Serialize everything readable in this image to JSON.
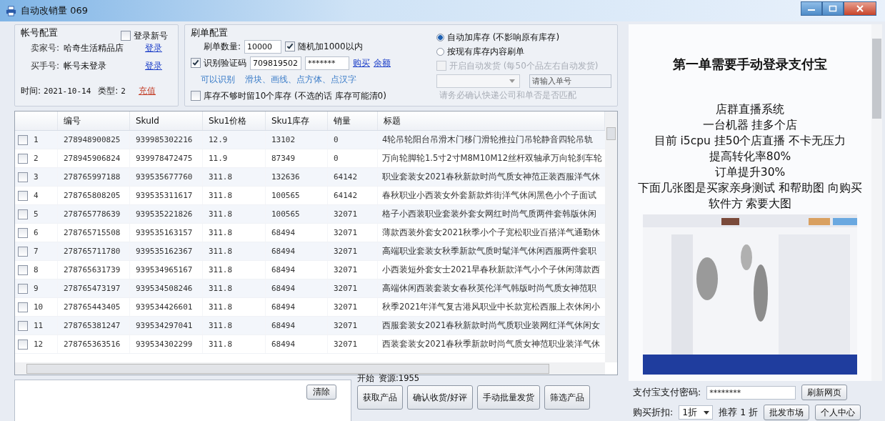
{
  "window": {
    "title": "自动改销量 069"
  },
  "account": {
    "title": "帐号配置",
    "login_new": {
      "label": "登录新号",
      "checked": false
    },
    "rows": [
      {
        "label": "卖家号:",
        "value": "哈奇生活精品店",
        "link": "登录"
      },
      {
        "label": "买手号:",
        "value": "帐号未登录",
        "link": "登录"
      }
    ],
    "time_label": "时间:",
    "time": "2021-10-14",
    "type_label": "类型:",
    "type": "2",
    "recharge": "充值"
  },
  "order_config": {
    "title": "刷单配置",
    "quantity_label": "刷单数量:",
    "quantity": "10000",
    "random": {
      "label": "随机加1000以内",
      "checked": true
    },
    "captcha": {
      "label": "识别验证码",
      "checked": true
    },
    "captcha_user": "709819502",
    "captcha_pass": "*******",
    "buy": "购买",
    "balance": "余额",
    "recognize_label": "可以识别",
    "recognize_types": "滑块、画线、点方体、点汉字",
    "keep_stock": {
      "label": "库存不够时留10个库存 (不选的话 库存可能清0)",
      "checked": false
    },
    "modes": [
      {
        "label": "自动加库存 (不影响原有库存)",
        "selected": true
      },
      {
        "label": "按现有库存内容刷单",
        "selected": false
      }
    ],
    "auto_ship": {
      "label": "开启自动发货 (每50个品左右自动发货)",
      "checked": false,
      "disabled": true
    },
    "order_no_placeholder": "请输入单号",
    "ship_note": "请务必确认快递公司和单否是否匹配"
  },
  "table": {
    "columns": [
      "编号",
      "SkuId",
      "Sku1价格",
      "Sku1库存",
      "销量",
      "标题"
    ],
    "rows": [
      {
        "checked": false,
        "n": "1",
        "cells": [
          "278948900825",
          "939985302216",
          "12.9",
          "13102",
          "0",
          "4轮吊轮阳台吊滑木门移门滑轮推拉门吊轮静音四轮吊轨"
        ]
      },
      {
        "checked": false,
        "n": "2",
        "cells": [
          "278945906824",
          "939978472475",
          "11.9",
          "87349",
          "0",
          "万向轮脚轮1.5寸2寸M8M10M12丝杆双轴承万向轮刹车轮"
        ]
      },
      {
        "checked": false,
        "n": "3",
        "cells": [
          "278765997188",
          "939535677760",
          "311.8",
          "132636",
          "64142",
          "职业套装女2021春秋新款时尚气质女神范正装西服洋气休"
        ]
      },
      {
        "checked": false,
        "n": "4",
        "cells": [
          "278765808205",
          "939535311617",
          "311.8",
          "100565",
          "64142",
          "春秋职业小西装女外套新款炸街洋气休闲黑色小个子面试"
        ]
      },
      {
        "checked": false,
        "n": "5",
        "cells": [
          "278765778639",
          "939535221826",
          "311.8",
          "100565",
          "32071",
          "格子小西装职业套装外套女网红时尚气质两件套韩版休闲"
        ]
      },
      {
        "checked": false,
        "n": "6",
        "cells": [
          "278765715508",
          "939535163157",
          "311.8",
          "68494",
          "32071",
          "薄款西装外套女2021秋季小个子宽松职业百搭洋气通勤休"
        ]
      },
      {
        "checked": false,
        "n": "7",
        "cells": [
          "278765711780",
          "939535162367",
          "311.8",
          "68494",
          "32071",
          "高端职业套装女秋季新款气质时髦洋气休闲西服两件套职"
        ]
      },
      {
        "checked": false,
        "n": "8",
        "cells": [
          "278765631739",
          "939534965167",
          "311.8",
          "68494",
          "32071",
          "小西装短外套女士2021早春秋新款洋气小个子休闲薄款西"
        ]
      },
      {
        "checked": false,
        "n": "9",
        "cells": [
          "278765473197",
          "939534508246",
          "311.8",
          "68494",
          "32071",
          "高端休闲西装套装女春秋英伦洋气韩版时尚气质女神范职"
        ]
      },
      {
        "checked": false,
        "n": "10",
        "cells": [
          "278765443405",
          "939534426601",
          "311.8",
          "68494",
          "32071",
          "秋季2021年洋气复古港风职业中长款宽松西服上衣休闲小"
        ]
      },
      {
        "checked": false,
        "n": "11",
        "cells": [
          "278765381247",
          "939534297041",
          "311.8",
          "68494",
          "32071",
          "西服套装女2021春秋新款时尚气质职业装网红洋气休闲女"
        ]
      },
      {
        "checked": false,
        "n": "12",
        "cells": [
          "278765363516",
          "939534302299",
          "311.8",
          "68494",
          "32071",
          "西装套装女2021春秋季新款时尚气质女神范职业装洋气休"
        ]
      }
    ]
  },
  "log": {
    "clear_button": "清除"
  },
  "actions": {
    "status": "开始",
    "resource": "资源:1955",
    "buttons": [
      "获取产品",
      "确认收货/好评",
      "手动批量发货",
      "筛选产品"
    ]
  },
  "ad_panel": {
    "heading": "第一单需要手动登录支付宝",
    "lines": [
      "店群直播系统",
      "一台机器 挂多个店",
      "目前 i5cpu 挂50个店直播 不卡无压力",
      "提高转化率80%",
      "订单提升30%",
      "下面几张图是买家亲身测试 和帮助图 向购买软件方 索要大图"
    ]
  },
  "payment": {
    "password_label": "支付宝支付密码:",
    "password": "********",
    "refresh_button": "刷新网页",
    "discount_label": "购买折扣:",
    "discount": "1折",
    "recommend": "推荐 1 折",
    "buttons": [
      "批发市场",
      "个人中心"
    ]
  }
}
